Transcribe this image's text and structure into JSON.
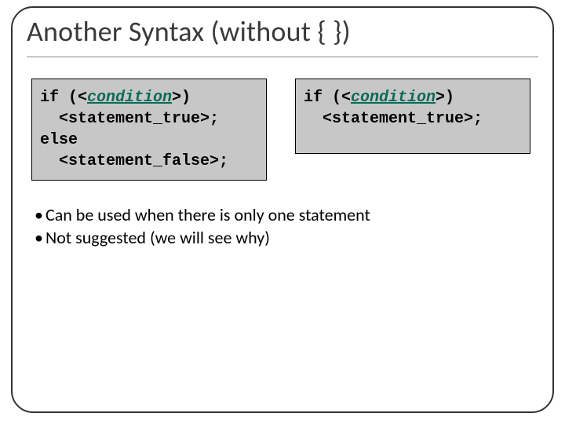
{
  "title": "Another Syntax (without { })",
  "code_left": {
    "l1a": "if (<",
    "l1b": "condition",
    "l1c": ">)",
    "l2": "  <statement_true>;",
    "l3": "else",
    "l4": "  <statement_false>;"
  },
  "code_right": {
    "l1a": "if (<",
    "l1b": "condition",
    "l1c": ">)",
    "l2": "  <statement_true>;"
  },
  "bullets": [
    "Can be used when there is only one statement",
    "Not suggested (we will see why)"
  ],
  "bullet_glyph": "•"
}
